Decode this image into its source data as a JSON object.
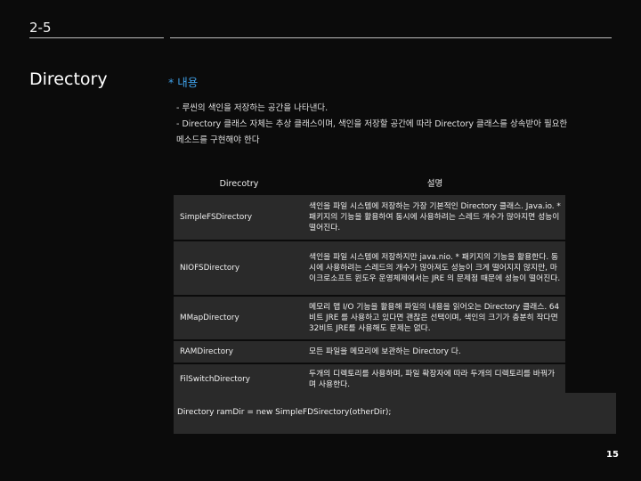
{
  "header": {
    "section_number": "2-5",
    "side_title": "Directory"
  },
  "content": {
    "heading": "* 내용",
    "bullets": [
      "- 루씬의 색인을 저장하는 공간을 나타낸다.",
      "- Directory 클래스 자체는 추상 클래스이며, 색인을 저장할 공간에 따라 Directory 클래스를 상속받아 필요한",
      "메소드를 구현해야 한다"
    ]
  },
  "table": {
    "headers": [
      "Direcotry",
      "설명"
    ],
    "rows": [
      {
        "name": "SimpleFSDirectory",
        "desc": "색인을 파일 시스템에 저장하는 가장 기본적인 Directory 클래스. Java.io. * 패키지의 기능을 활용하여 동시에 사용하려는 스레드 개수가 많아지면 성능이 떨어진다."
      },
      {
        "name": "NIOFSDirectory",
        "desc": "색인을 파일 시스템에 저장하지만 java.nio. * 패키지의 기능을 활용한다. 동시에 사용하려는 스레드의 개수가 많아져도 성능이 크게 떨어지지 않지만, 마이크로소프트 윈도우 운영체제에서는 JRE 의 문제점 때문에 성능이 떨어진다."
      },
      {
        "name": "MMapDirectory",
        "desc": "메모리 맵 I/O 기능을 활용해 파일의 내용을 읽어오는 Directory 클래스. 64비트 JRE 를 사용하고 있다면 괜찮은 선택이며, 색인의 크기가 충분히 작다면 32비트 JRE를 사용해도 문제는 없다."
      },
      {
        "name": "RAMDirectory",
        "desc": "모든 파일을 메모리에 보관하는 Directory 다."
      },
      {
        "name": "FilSwitchDirectory",
        "desc": "두개의 디렉토리를 사용하며, 파일 확장자에 따라 두개의 디렉토리를 바꿔가며 사용한다."
      }
    ]
  },
  "code": "Directory ramDir = new SimpleFDSirectory(otherDir);",
  "page_number": "15",
  "colors": {
    "background": "#0b0b0b",
    "heading_accent": "#3fa0e8",
    "cell_background": "#2a2a2a"
  }
}
